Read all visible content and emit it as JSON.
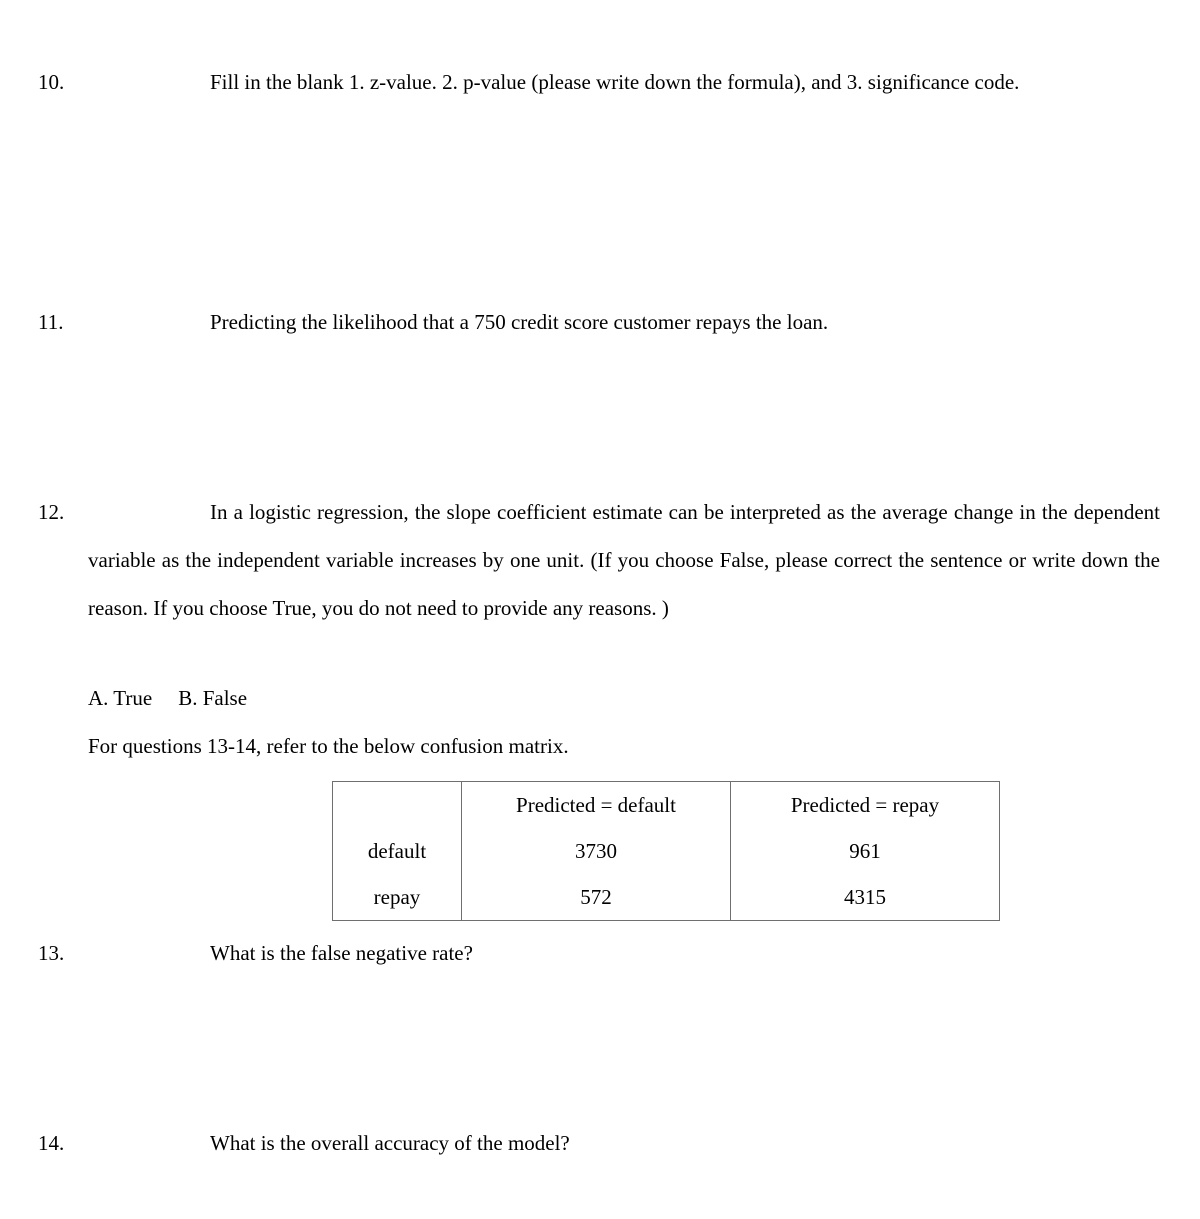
{
  "document": {
    "type": "exam-worksheet",
    "background_color": "#ffffff",
    "text_color": "#000000"
  },
  "questions": [
    {
      "number": "10.",
      "text": "Fill in the blank 1.  z-value.   2.  p-value (please write down the formula), and 3. significance code."
    },
    {
      "number": "11.",
      "text": "Predicting the likelihood that a 750 credit score customer repays the loan."
    },
    {
      "number": "12.",
      "text": "In a logistic regression, the slope coefficient estimate can be interpreted as the average change in the dependent variable as the independent variable increases by one unit.  (If you choose False, please correct the sentence or write down the reason. If you choose True, you do not need to provide any reasons.  )"
    },
    {
      "number": "13.",
      "text": "What is the false negative rate?"
    },
    {
      "number": "14.",
      "text": "What is the overall accuracy of the model?"
    }
  ],
  "choices": {
    "option_a": "A.  True",
    "option_b": "B.  False"
  },
  "instruction": "For questions 13-14, refer to the below confusion matrix.",
  "confusion_matrix": {
    "corner_label": "",
    "column_headers": [
      "Predicted = default",
      "Predicted = repay"
    ],
    "row_headers": [
      "default",
      "repay"
    ],
    "rows": [
      {
        "label": "default",
        "values": [
          "3730",
          "961"
        ]
      },
      {
        "label": "repay",
        "values": [
          "572",
          "4315"
        ]
      }
    ],
    "border_color": "#6f6f6f"
  }
}
